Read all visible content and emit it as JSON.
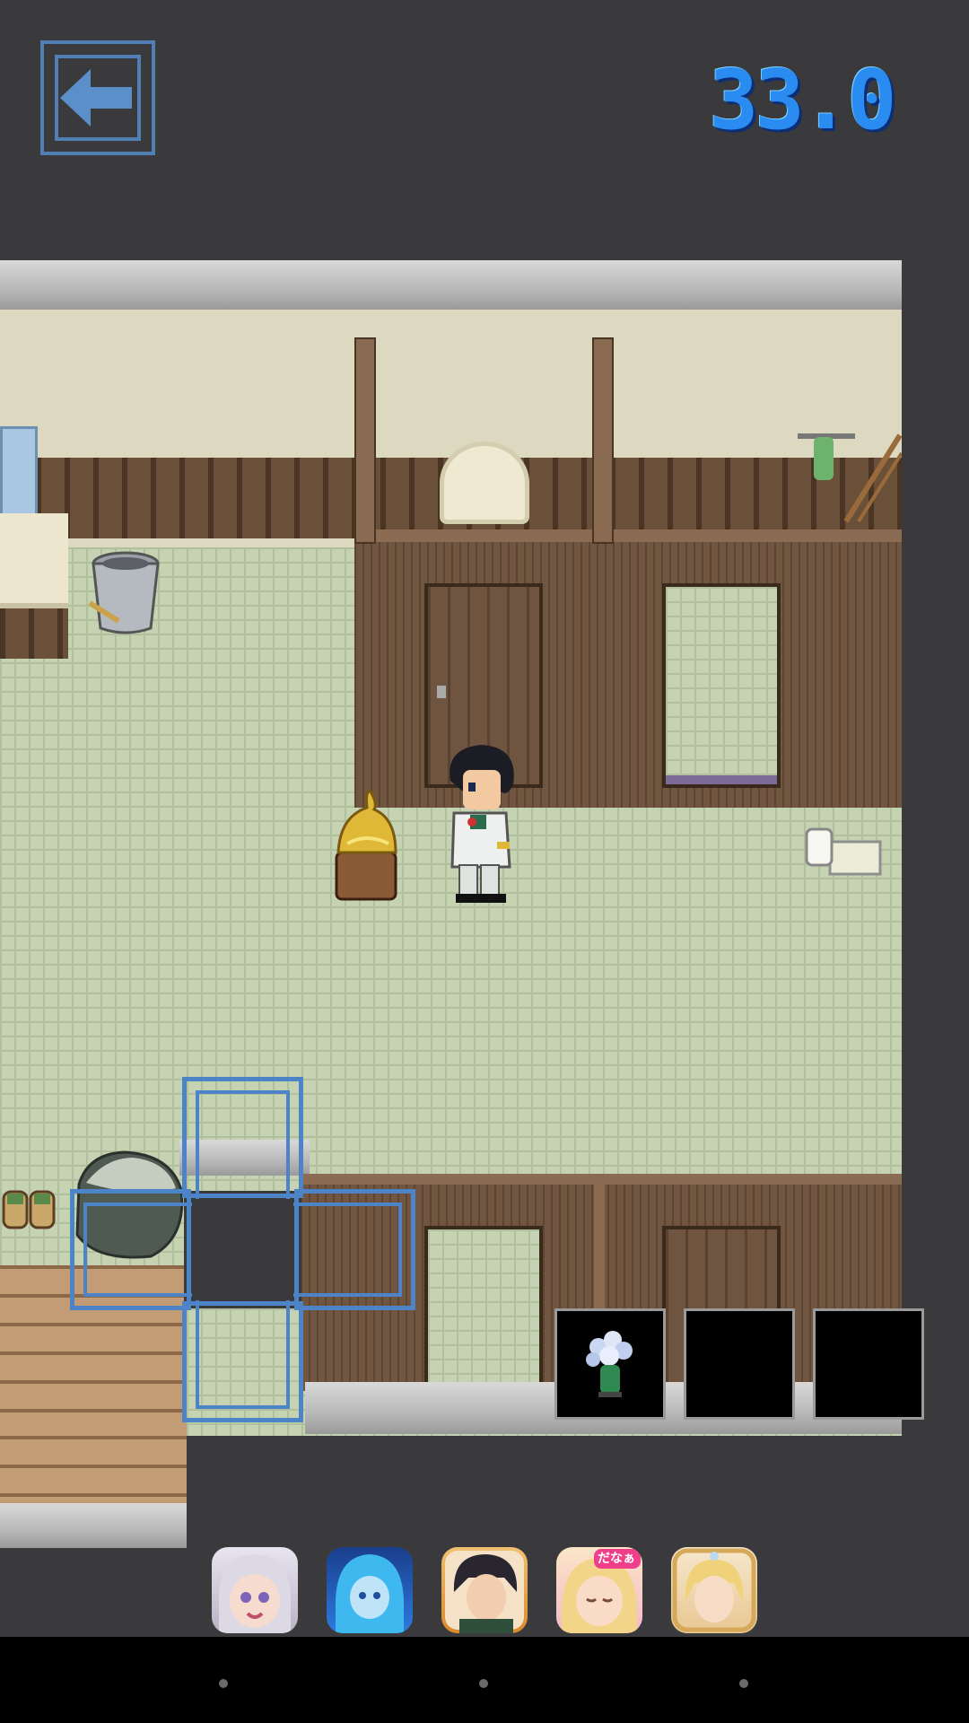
{
  "hud": {
    "back_icon": "left-arrow-icon",
    "timer": "33.0"
  },
  "inventory": {
    "slots": [
      {
        "item": "flower-vase-icon"
      },
      {
        "item": ""
      },
      {
        "item": ""
      }
    ]
  },
  "ad_bar": {
    "apps": [
      {
        "icon": "silver-hair-girl-app-icon",
        "color": "#cfc9d8"
      },
      {
        "icon": "blue-mermaid-app-icon",
        "color": "#2d7be0"
      },
      {
        "icon": "dark-hair-man-app-icon",
        "color": "#e8a24a"
      },
      {
        "icon": "blonde-girl-danaa-app-icon",
        "color": "#f3b9c9",
        "badge": "だなぁ"
      },
      {
        "icon": "blonde-prince-app-icon",
        "color": "#f1d9b5"
      }
    ]
  },
  "colors": {
    "accent": "#4c84c7",
    "timer": "#2a8cf0",
    "background": "#3a3a3c"
  }
}
